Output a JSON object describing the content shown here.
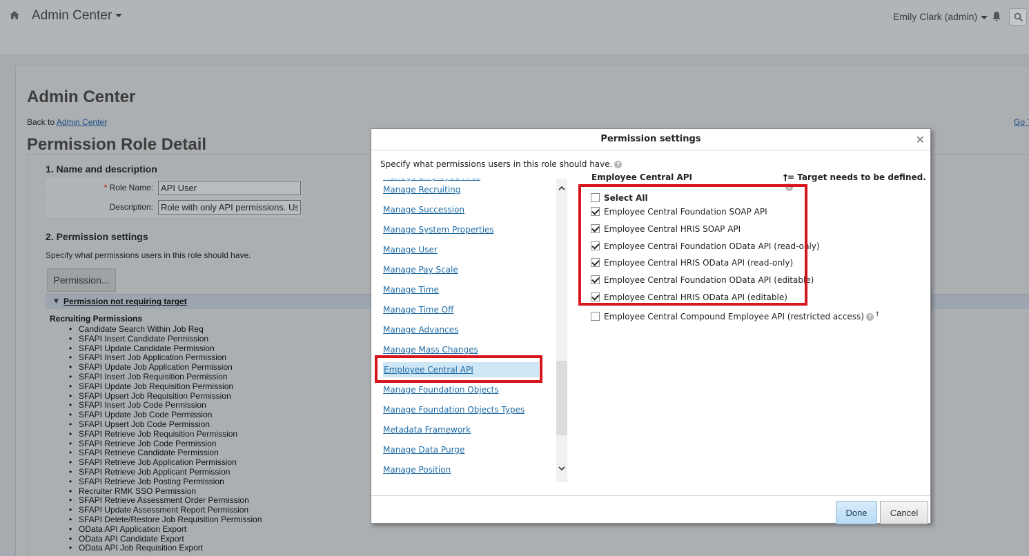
{
  "topbar": {
    "title": "Admin Center",
    "user": "Emily Clark (admin)",
    "icons": [
      "home-icon",
      "bell-icon",
      "search-icon",
      "chevron-down-icon"
    ]
  },
  "page": {
    "heading": "Admin Center",
    "back_prefix": "Back to",
    "back_link": "Admin Center",
    "goto_link": "Go T",
    "title": "Permission Role Detail",
    "section1": "1. Name and description",
    "role_name_label": "Role Name:",
    "role_name_value": "API User",
    "description_label": "Description:",
    "description_value": "Role with only API permissions. Us",
    "section2": "2. Permission settings",
    "section2_desc": "Specify what permissions users in this role should have.",
    "permission_button": "Permission...",
    "group_toggle": "Permission not requiring target",
    "recruiting_heading": "Recruiting Permissions",
    "recruiting_items": [
      "Candidate Search Within Job Req",
      "SFAPI Insert Candidate Permission",
      "SFAPI Update Candidate Permission",
      "SFAPI Insert Job Application Permission",
      "SFAPI Update Job Application Permission",
      "SFAPI Insert Job Requisition Permission",
      "SFAPI Update Job Requisition Permission",
      "SFAPI Upsert Job Requisition Permission",
      "SFAPI Insert Job Code Permission",
      "SFAPI Update Job Code Permission",
      "SFAPI Upsert Job Code Permission",
      "SFAPI Retrieve Job Requisition Permission",
      "SFAPI Retrieve Job Code Permission",
      "SFAPI Retrieve Candidate Permission",
      "SFAPI Retrieve Job Application Permission",
      "SFAPI Retrieve Job Applicant Permission",
      "SFAPI Retrieve Job Posting Permission",
      "Recruiter RMK SSO Permission",
      "SFAPI Retrieve Assessment Order Permission",
      "SFAPI Update Assessment Report Permission",
      "SFAPI Delete/Restore Job Requisition Permission",
      "OData API Application Export",
      "OData API Candidate Export",
      "OData API Job Requisition Export"
    ]
  },
  "modal": {
    "title": "Permission settings",
    "description": "Specify what permissions users in this role should have.",
    "categories": [
      "Manage Recruiting",
      "Manage Succession",
      "Manage System Properties",
      "Manage User",
      "Manage Pay Scale",
      "Manage Time",
      "Manage Time Off",
      "Manage Advances",
      "Manage Mass Changes",
      "Employee Central API",
      "Manage Foundation Objects",
      "Manage Foundation Objects Types",
      "Metadata Framework",
      "Manage Data Purge",
      "Manage Position"
    ],
    "selected_category": "Employee Central API",
    "panel_heading": "Employee Central API",
    "target_note": "†= Target needs to be defined.",
    "select_all": "Select All",
    "permissions": [
      {
        "label": "Employee Central Foundation SOAP API",
        "checked": true
      },
      {
        "label": "Employee Central HRIS SOAP API",
        "checked": true
      },
      {
        "label": "Employee Central Foundation OData API (read-only)",
        "checked": true
      },
      {
        "label": "Employee Central HRIS OData API (read-only)",
        "checked": true
      },
      {
        "label": "Employee Central Foundation OData API (editable)",
        "checked": true
      },
      {
        "label": "Employee Central HRIS OData API (editable)",
        "checked": true
      },
      {
        "label": "Employee Central Compound Employee API (restricted access)",
        "checked": false
      }
    ],
    "dagger": "†",
    "done": "Done",
    "cancel": "Cancel"
  },
  "colors": {
    "highlight": "#d6151d",
    "link": "#1c6aa5",
    "selected_bg": "#cfe6f4"
  }
}
